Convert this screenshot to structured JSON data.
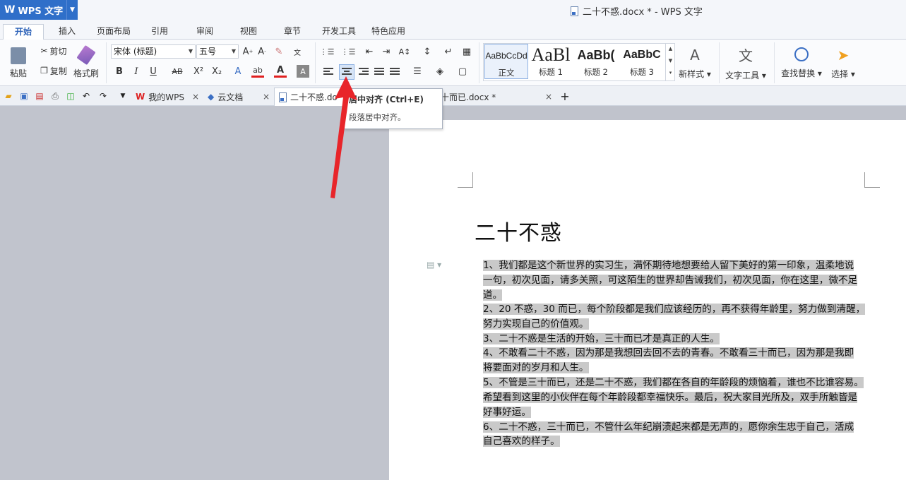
{
  "app": {
    "name": "WPS 文字",
    "window_title": "二十不惑.docx * - WPS 文字"
  },
  "menu_tabs": [
    "开始",
    "插入",
    "页面布局",
    "引用",
    "审阅",
    "视图",
    "章节",
    "开发工具",
    "特色应用"
  ],
  "ribbon": {
    "paste": "粘贴",
    "cut": "剪切",
    "copy": "复制",
    "format_painter": "格式刷",
    "font_name": "宋体 (标题)",
    "font_size": "五号",
    "bold": "B",
    "italic": "I",
    "underline": "U",
    "strikethrough": "AB",
    "superscript": "X²",
    "subscript": "X₂",
    "font_color": "A",
    "highlight": "ab",
    "styles": [
      {
        "preview": "AaBbCcDd",
        "label": "正文"
      },
      {
        "preview": "AaBl",
        "label": "标题 1"
      },
      {
        "preview": "AaBb(",
        "label": "标题 2"
      },
      {
        "preview": "AaBbC",
        "label": "标题 3"
      }
    ],
    "new_style": "新样式",
    "text_tools": "文字工具",
    "find_replace": "查找替换",
    "select": "选择"
  },
  "doc_tabs": [
    {
      "label": "我的WPS"
    },
    {
      "label": "云文档"
    },
    {
      "label": "二十不惑.do"
    },
    {
      "label": "十而已.docx *"
    }
  ],
  "new_tab": "+",
  "tooltip": {
    "title": "居中对齐 (Ctrl+E)",
    "description": "段落居中对齐。"
  },
  "document": {
    "title": "二十不惑",
    "lines": [
      "1、我们都是这个新世界的实习生，满怀期待地想要给人留下美好的第一印象，温柔地说",
      "一句，初次见面，请多关照，可这陌生的世界却告诫我们，初次见面，你在这里，微不足",
      "道。",
      "2、20 不惑，30 而已，每个阶段都是我们应该经历的，再不获得年龄里，努力做到清醒，",
      "努力实现自己的价值观。",
      "3、二十不惑是生活的开始，三十而已才是真正的人生。",
      "4、不敢看二十不惑，因为那是我想回去回不去的青春。不敢看三十而已，因为那是我即",
      "将要面对的岁月和人生。",
      "5、不管是三十而已，还是二十不惑，我们都在各自的年龄段的烦恼着，谁也不比谁容易。",
      "希望看到这里的小伙伴在每个年龄段都幸福快乐。最后，祝大家目光所及，双手所触皆是",
      "好事好运。",
      "6、二十不惑，三十而已，不管什么年纪崩溃起来都是无声的，愿你余生忠于自己，活成",
      "自己喜欢的样子。"
    ]
  },
  "colors": {
    "accent": "#2f6fc9",
    "arrow": "#e8252a",
    "selection": "#c9c9c9"
  }
}
